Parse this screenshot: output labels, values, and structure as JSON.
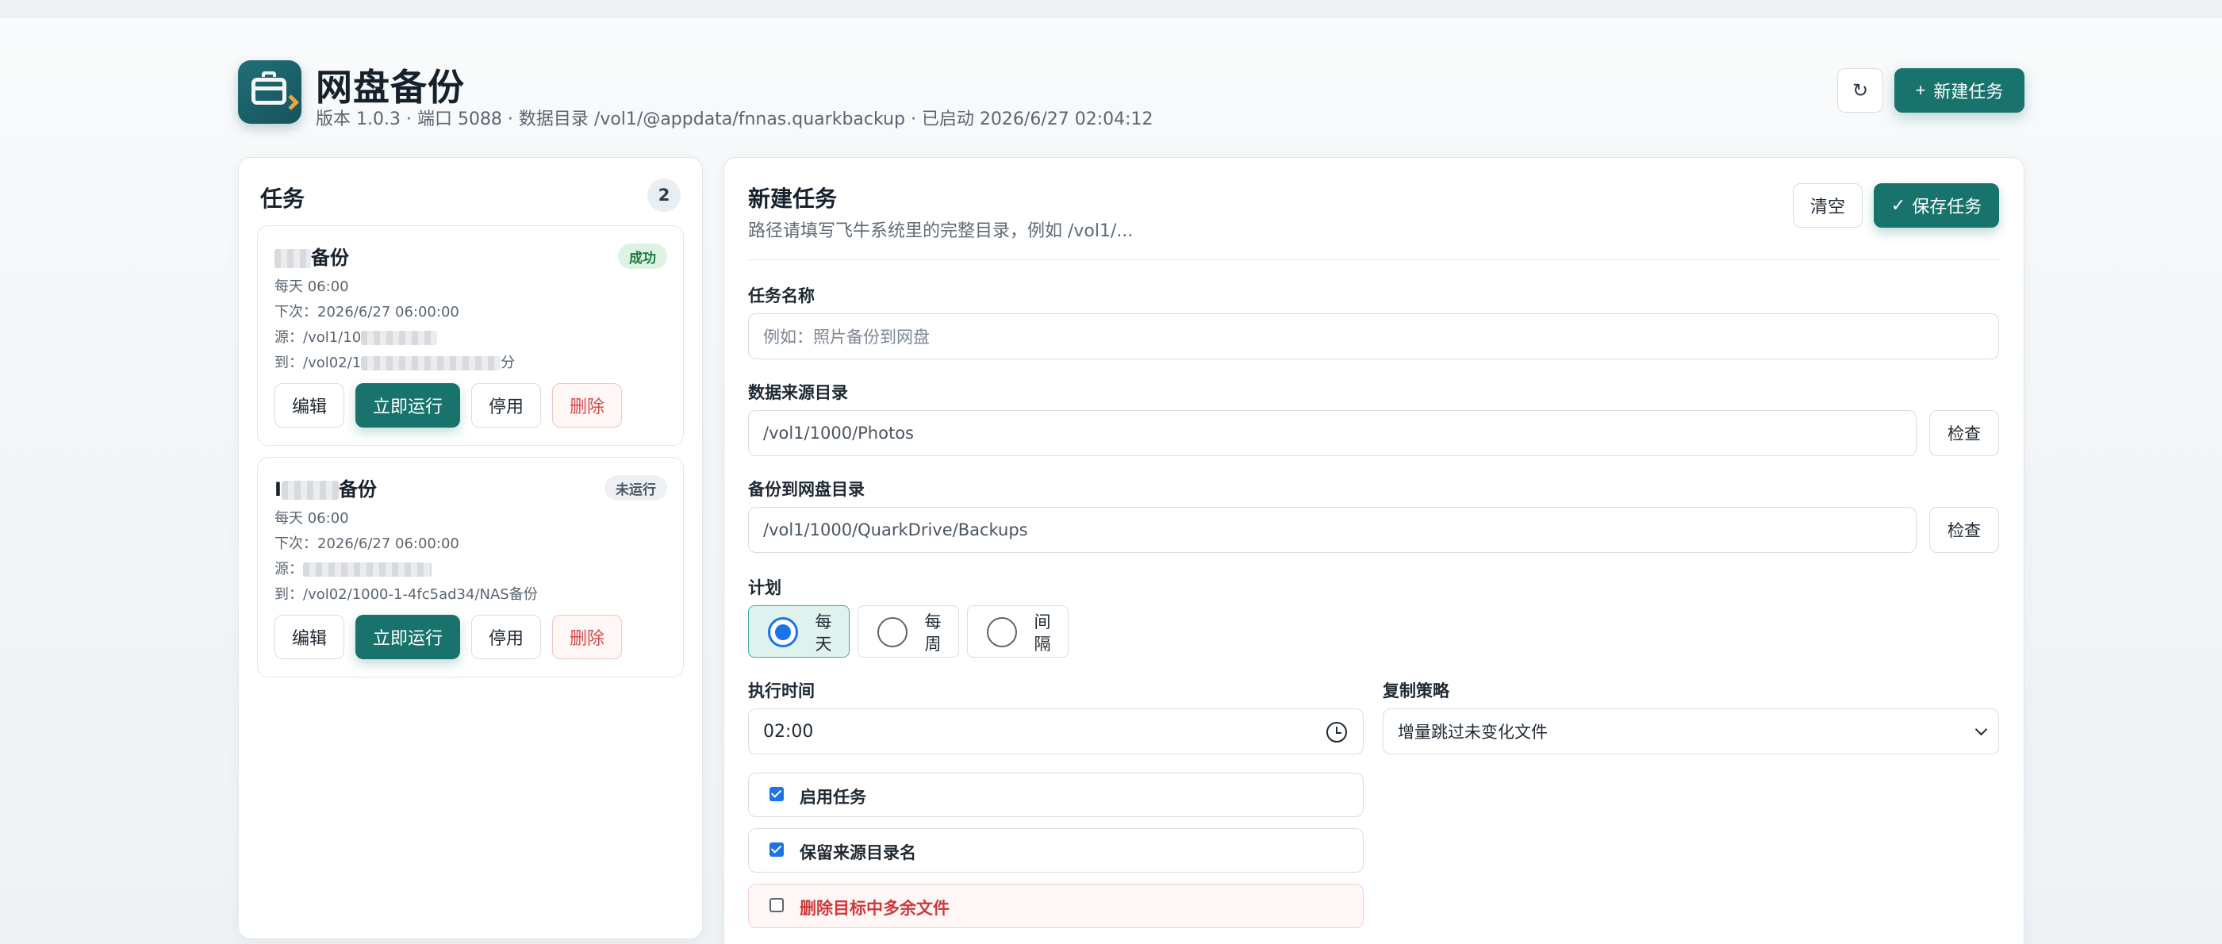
{
  "app": {
    "title": "网盘备份",
    "meta": "版本 1.0.3 · 端口 5088 · 数据目录 /vol1/@appdata/fnnas.quarkbackup · 已启动 2026/6/27 02:04:12",
    "refresh_icon": "↻",
    "new_task_label": "新建任务",
    "new_task_icon": "+"
  },
  "tasks_panel": {
    "title": "任务",
    "count": "2",
    "actions": {
      "edit": "编辑",
      "run": "立即运行",
      "disable": "停用",
      "delete": "删除"
    },
    "items": [
      {
        "name": "备份",
        "status": "成功",
        "schedule": "每天 06:00",
        "next": "下次：2026/6/27 06:00:00",
        "source_prefix": "源：/vol1/10",
        "dest_prefix": "到：/vol02/1",
        "dest_suffix": "分"
      },
      {
        "name_prefix": "I",
        "name_suffix": "备份",
        "status": "未运行",
        "schedule": "每天 06:00",
        "next": "下次：2026/6/27 06:00:00",
        "source_prefix": "源：",
        "dest": "到：/vol02/1000-1-4fc5ad34/NAS备份"
      }
    ]
  },
  "form": {
    "title": "新建任务",
    "subtitle": "路径请填写飞牛系统里的完整目录，例如 /vol1/...",
    "clear_label": "清空",
    "save_label": "保存任务",
    "save_icon": "✓",
    "name_label": "任务名称",
    "name_placeholder": "例如：照片备份到网盘",
    "source_label": "数据来源目录",
    "source_value": "/vol1/1000/Photos",
    "dest_label": "备份到网盘目录",
    "dest_value": "/vol1/1000/QuarkDrive/Backups",
    "check_label": "检查",
    "schedule_label": "计划",
    "schedule_options": [
      {
        "line1": "每",
        "line2": "天",
        "selected": true
      },
      {
        "line1": "每",
        "line2": "周",
        "selected": false
      },
      {
        "line1": "间",
        "line2": "隔",
        "selected": false
      }
    ],
    "time_label": "执行时间",
    "time_value": "02:00",
    "strategy_label": "复制策略",
    "strategy_value": "增量跳过未变化文件",
    "options": [
      {
        "label": "启用任务",
        "checked": true
      },
      {
        "label": "保留来源目录名",
        "checked": true
      },
      {
        "label": "删除目标中多余文件",
        "checked": false
      }
    ]
  },
  "colors": {
    "accent": "#17736b",
    "success_badge": "#dcf3e4",
    "danger": "#d44a4a",
    "radio_blue": "#1a73e8"
  }
}
